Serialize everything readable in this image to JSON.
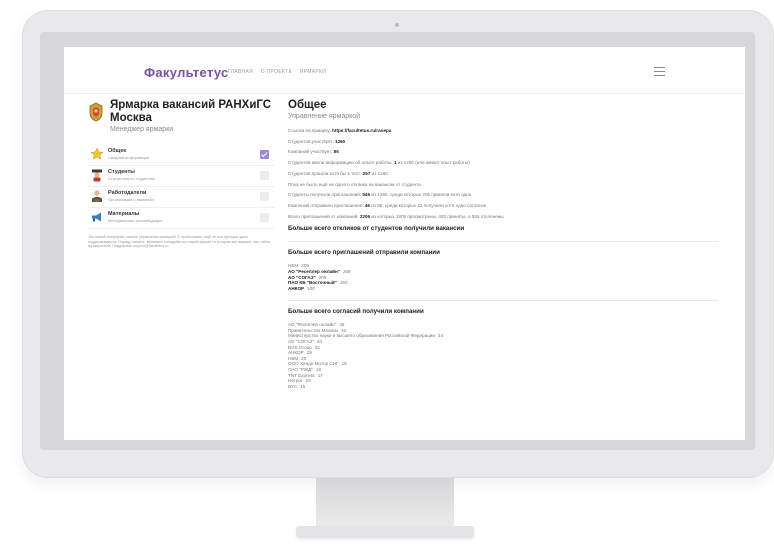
{
  "header": {
    "logo": "Факультетус",
    "nav": [
      "ГЛАВНАЯ",
      "О ПРОЕКТЕ",
      "ЯРМАРКИ"
    ]
  },
  "fair": {
    "title": "Ярмарка вакансий РАНХиГС Москва",
    "subtitle": "Менеджер ярмарки"
  },
  "menu": [
    {
      "title": "Общее",
      "subtitle": "Сводная информация",
      "checked": true,
      "icon": "star-icon"
    },
    {
      "title": "Студенты",
      "subtitle": "Статистика по студентам",
      "checked": false,
      "icon": "students-icon"
    },
    {
      "title": "Работодатели",
      "subtitle": "Организации и вакансии",
      "checked": false,
      "icon": "employers-icon"
    },
    {
      "title": "Материалы",
      "subtitle": "Методические рекомендации",
      "checked": false,
      "icon": "megaphone-icon"
    }
  ],
  "note": "Это новый интерфейс панели управления ярмаркой. С проблемами, ещё не все функции здесь поддерживаются. Наряду, пишите, возможно понадобится старый вариант в котором все вариант, как, найти функционала. Поддержка: support@facultetus.ru",
  "main": {
    "title": "Общее",
    "subtitle": "Управление ярмаркой",
    "stats": [
      {
        "label": "Ссылка на ярмарку:",
        "value": "https://facultetus.ru/ranepa",
        "rest": ""
      },
      {
        "label": "Студентов участвует:",
        "value": "1260",
        "rest": ""
      },
      {
        "label": "Компаний участвует:",
        "value": "86",
        "rest": ""
      },
      {
        "label": "Студентов ввели информацию об опыте работы:",
        "value": "1",
        "rest": "из 1260 (или имеют опыт работы)"
      },
      {
        "label": "Студентов прошли хотя бы 1 тест:",
        "value": "257",
        "rest": "из 1260"
      },
      {
        "label": "Пока не было ещё ни одного отклика на вакансии от студента",
        "value": "",
        "rest": ""
      },
      {
        "label": "Студенты получили приглашений:",
        "value": "546",
        "rest": "из 1260, среди которых 206 приняли хотя одно"
      },
      {
        "label": "Компаний отправили приглашения:",
        "value": "46",
        "rest": "из 86, среди которых 42 получили хотя одно согласие"
      },
      {
        "label": "Всего приглашений от компаний:",
        "value": "2206",
        "rest": "из которых 1806 просмотрены, 493 приняты, а 555 отклонены"
      }
    ],
    "section1": "Больше всего откликов от студентов получили вакансии",
    "section2": "Больше всего приглашений отправили компании",
    "invites": [
      {
        "name": "НБМ",
        "value": "209",
        "bold": false
      },
      {
        "name": "АО \"Ресеплер онлайн\"",
        "value": "208",
        "bold": true
      },
      {
        "name": "АО \"СОГАЗ\"",
        "value": "205",
        "bold": true
      },
      {
        "name": "ПАО КБ \"Восточный\"",
        "value": "150",
        "bold": true
      },
      {
        "name": "АНКОР",
        "value": "100",
        "bold": true
      }
    ],
    "section3": "Больше всего согласий получили компании",
    "consents": [
      {
        "name": "АО \"Ресеплер онлайн\"",
        "value": "45"
      },
      {
        "name": "Правительство Москвы",
        "value": "42"
      },
      {
        "name": "Министерство науки и высшего образования Российской Федерации",
        "value": "34"
      },
      {
        "name": "АО \"СОГАЗ\"",
        "value": "34"
      },
      {
        "name": "BGS Group",
        "value": "32"
      },
      {
        "name": "АНКОР",
        "value": "29"
      },
      {
        "name": "НБМ",
        "value": "20"
      },
      {
        "name": "ООО Хенде Мотор СНГ",
        "value": "18"
      },
      {
        "name": "ОАО \"РЖД\"",
        "value": "18"
      },
      {
        "name": "TNT Express",
        "value": "17"
      },
      {
        "name": "Нетрог",
        "value": "16"
      },
      {
        "name": "ВУС",
        "value": "15"
      }
    ]
  },
  "colors": {
    "brand": "#7e4f9e",
    "check": "#9b8ad3"
  }
}
